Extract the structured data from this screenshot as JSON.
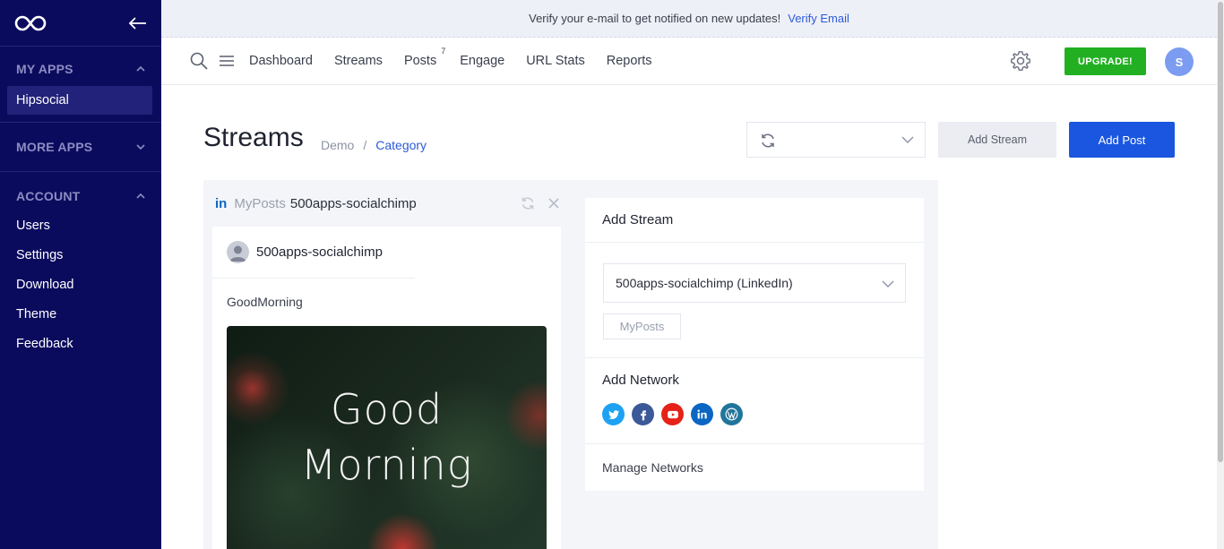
{
  "sidebar": {
    "sections": [
      {
        "title": "MY APPS",
        "items": [
          "Hipsocial"
        ]
      },
      {
        "title": "MORE APPS",
        "items": []
      },
      {
        "title": "ACCOUNT",
        "items": [
          "Users",
          "Settings",
          "Download",
          "Theme",
          "Feedback"
        ]
      }
    ]
  },
  "banner": {
    "text": "Verify your e-mail to get notified on new updates!",
    "link": "Verify Email"
  },
  "nav": {
    "links": [
      "Dashboard",
      "Streams",
      "Posts",
      "Engage",
      "URL Stats",
      "Reports"
    ],
    "posts_badge": "7",
    "upgrade": "UPGRADE!",
    "avatar_initial": "S"
  },
  "page": {
    "title": "Streams",
    "breadcrumb": {
      "item1": "Demo",
      "separator": "/",
      "item2": "Category"
    },
    "add_stream_button": "Add Stream",
    "add_post_button": "Add Post"
  },
  "stream_column": {
    "network_icon": "in",
    "type": "MyPosts",
    "account": "500apps-socialchimp",
    "post": {
      "user": "500apps-socialchimp",
      "text": "GoodMorning",
      "image_line1": "Good",
      "image_line2": "Morning"
    }
  },
  "add_stream_panel": {
    "title": "Add Stream",
    "account_select": "500apps-socialchimp (LinkedIn)",
    "chip": "MyPosts",
    "network_title": "Add Network",
    "networks": [
      "twitter",
      "facebook",
      "youtube",
      "linkedin",
      "wordpress"
    ],
    "manage": "Manage Networks"
  },
  "colors": {
    "sidebar": "#0b0b5e",
    "primary": "#1a56e0",
    "upgrade": "#22b022",
    "link": "#2d5bd6"
  }
}
